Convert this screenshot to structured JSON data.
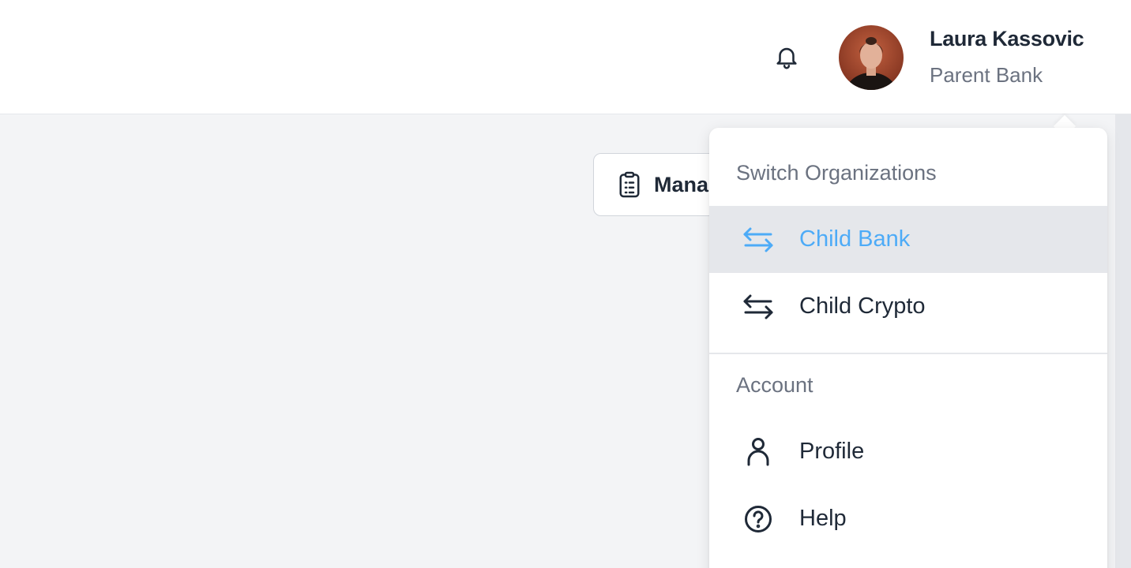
{
  "header": {
    "user": {
      "name": "Laura Kassovic",
      "organization": "Parent Bank"
    },
    "notifications_icon": "bell-icon"
  },
  "main": {
    "manage_button": {
      "label": "Mana",
      "icon": "clipboard-icon"
    }
  },
  "menu": {
    "switch_heading": "Switch Organizations",
    "organizations": [
      {
        "label": "Child Bank",
        "icon": "switch-arrows-icon",
        "active": true
      },
      {
        "label": "Child Crypto",
        "icon": "switch-arrows-icon",
        "active": false
      }
    ],
    "account_heading": "Account",
    "account_items": [
      {
        "label": "Profile",
        "icon": "user-icon"
      },
      {
        "label": "Help",
        "icon": "help-circle-icon"
      }
    ]
  },
  "colors": {
    "accent": "#4dabf7",
    "active_row": "#e5e7eb",
    "page_bg": "#f3f4f6",
    "text_primary": "#1f2937",
    "text_secondary": "#6b7280"
  }
}
